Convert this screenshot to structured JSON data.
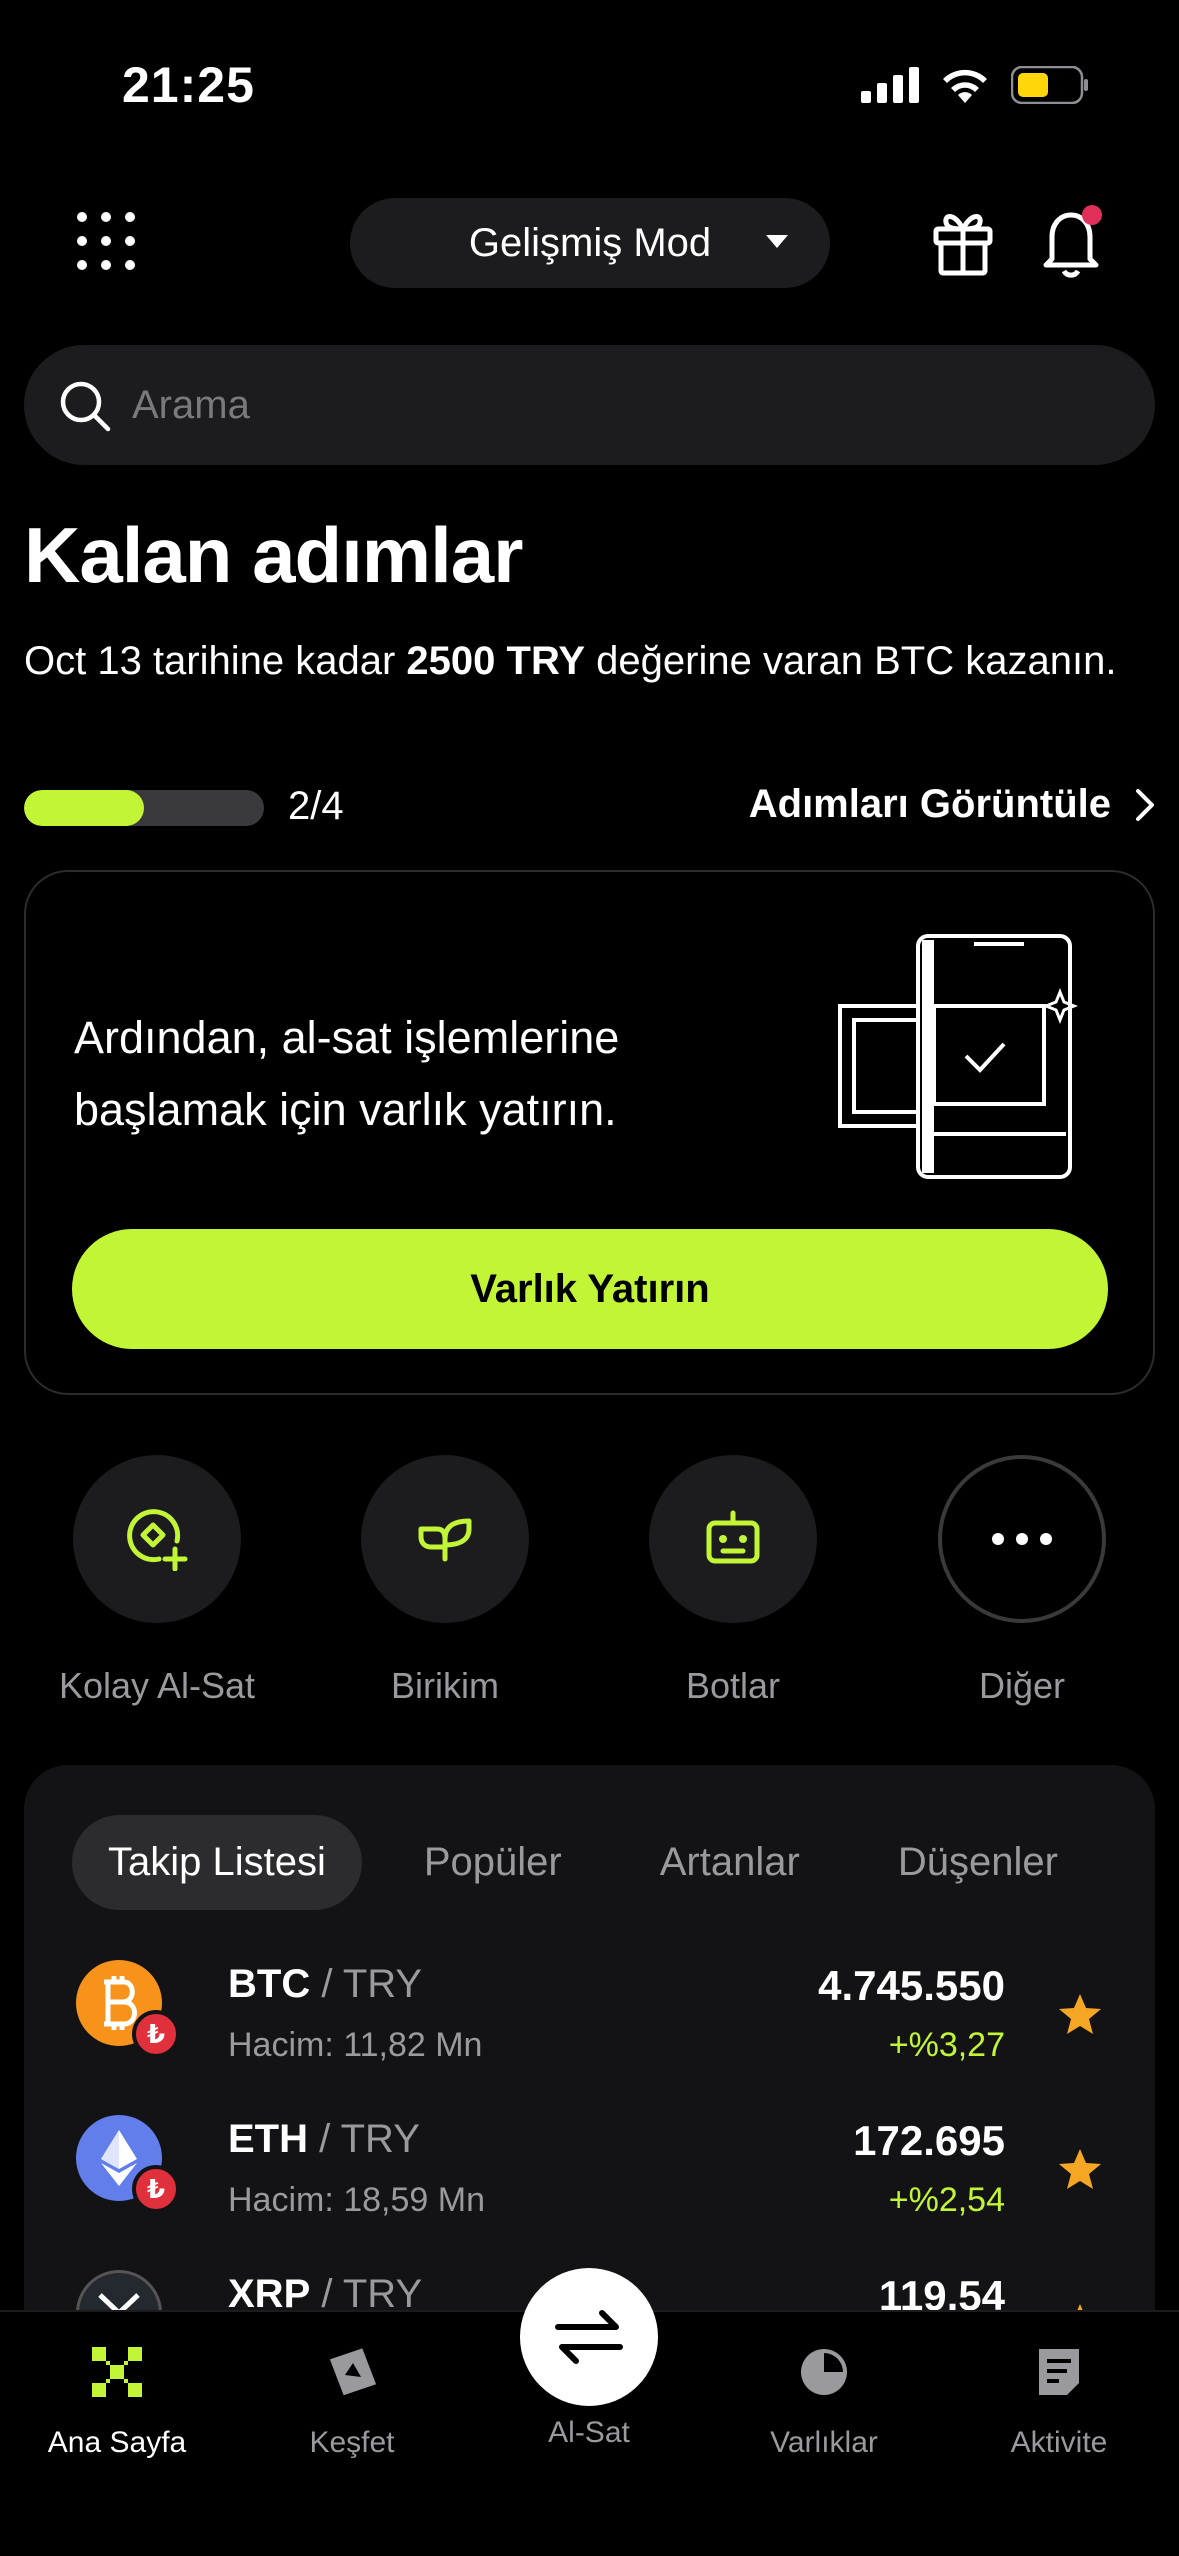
{
  "status_bar": {
    "time": "21:25"
  },
  "header": {
    "mode_label": "Gelişmiş Mod"
  },
  "search": {
    "placeholder": "Arama"
  },
  "steps": {
    "title": "Kalan adımlar",
    "desc_prefix": "Oct 13 tarihine kadar ",
    "desc_bold": "2500 TRY",
    "desc_suffix": " değerine varan BTC kazanın.",
    "progress_text": "2/4",
    "progress_fraction": 0.5,
    "view_label": "Adımları Görüntüle"
  },
  "deposit_card": {
    "text": "Ardından, al-sat işlemlerine başlamak için varlık yatırın.",
    "button_label": "Varlık Yatırın"
  },
  "quick_actions": [
    {
      "label": "Kolay Al-Sat",
      "icon": "easy-trade-icon"
    },
    {
      "label": "Birikim",
      "icon": "sprout-icon"
    },
    {
      "label": "Botlar",
      "icon": "robot-icon"
    },
    {
      "label": "Diğer",
      "icon": "more-icon"
    }
  ],
  "market": {
    "tabs": [
      "Takip Listesi",
      "Popüler",
      "Artanlar",
      "Düşenler"
    ],
    "active_tab": 0,
    "rows": [
      {
        "base": "BTC",
        "quote": " / TRY",
        "volume": "Hacim: 11,82 Mn",
        "price": "4.745.550",
        "change": "+%3,27",
        "coin_color": "#f7931a",
        "icon": "bitcoin-icon"
      },
      {
        "base": "ETH",
        "quote": " / TRY",
        "volume": "Hacim: 18,59 Mn",
        "price": "172.695",
        "change": "+%2,54",
        "coin_color": "#627eea",
        "icon": "ethereum-icon"
      },
      {
        "base": "XRP",
        "quote": " / TRY",
        "volume": "",
        "price": "119,54",
        "change": "",
        "coin_color": "#23292f",
        "icon": "xrp-icon"
      }
    ],
    "badge_glyph": "₺"
  },
  "tabbar": {
    "items": [
      {
        "label": "Ana Sayfa",
        "icon": "home-icon"
      },
      {
        "label": "Keşfet",
        "icon": "explore-icon"
      },
      {
        "label": "Al-Sat",
        "icon": "swap-icon"
      },
      {
        "label": "Varlıklar",
        "icon": "assets-pie-icon"
      },
      {
        "label": "Aktivite",
        "icon": "activity-icon"
      }
    ]
  },
  "colors": {
    "accent": "#c2f535",
    "star": "#f5a623",
    "notification_dot": "#e0305a",
    "battery": "#ffd60a"
  }
}
